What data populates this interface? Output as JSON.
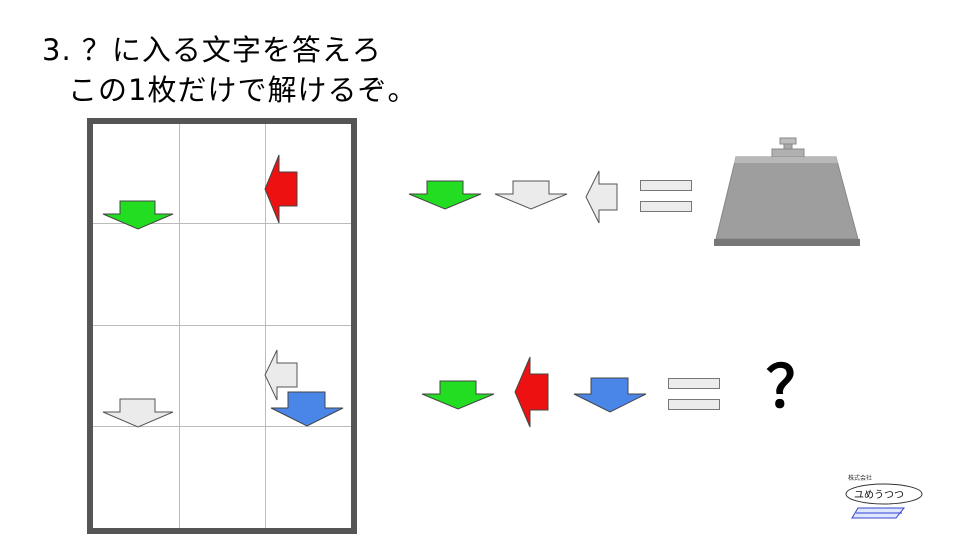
{
  "puzzle": {
    "title_line1": "3. ？に入る文字を答えろ",
    "title_line2": "この1枚だけで解けるぞ。",
    "question_mark": "？"
  },
  "logo": {
    "small_text": "株式会社",
    "name": "ユめうつつ"
  },
  "colors": {
    "green": "#22dd22",
    "red": "#ee1111",
    "blue": "#4a86e8",
    "white_arrow": "#ebebeb",
    "grid_border": "#555555",
    "weight": "#9e9e9e"
  },
  "icons": {
    "grid_r1c1": "green-down-arrow-icon",
    "grid_r1c3": "red-left-arrow-icon",
    "grid_r3c3": "white-left-arrow-icon",
    "grid_r4c1": "white-down-arrow-icon",
    "grid_r4c3": "blue-down-arrow-icon",
    "eq1": [
      "green-down-arrow-icon",
      "white-down-arrow-icon",
      "white-left-arrow-icon",
      "equals-icon",
      "weight-icon"
    ],
    "eq2": [
      "green-down-arrow-icon",
      "red-left-arrow-icon",
      "blue-down-arrow-icon",
      "equals-icon",
      "question-mark"
    ]
  }
}
